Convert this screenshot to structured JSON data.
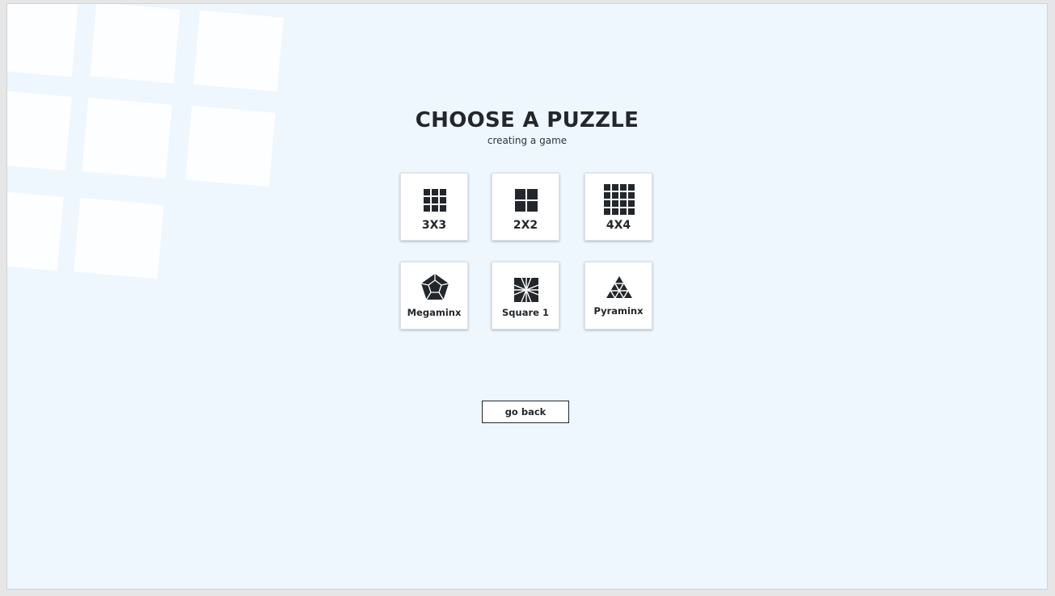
{
  "header": {
    "title": "CHOOSE A PUZZLE",
    "subtitle": "creating a game"
  },
  "puzzles": [
    {
      "label": "3X3",
      "icon": "grid-3x3-icon"
    },
    {
      "label": "2X2",
      "icon": "grid-2x2-icon"
    },
    {
      "label": "4X4",
      "icon": "grid-4x4-icon"
    },
    {
      "label": "Megaminx",
      "icon": "megaminx-icon"
    },
    {
      "label": "Square 1",
      "icon": "square-one-icon"
    },
    {
      "label": "Pyraminx",
      "icon": "pyraminx-icon"
    }
  ],
  "actions": {
    "back_label": "go back"
  },
  "colors": {
    "background": "#eef6fe",
    "card": "#ffffff",
    "text": "#23272b"
  }
}
